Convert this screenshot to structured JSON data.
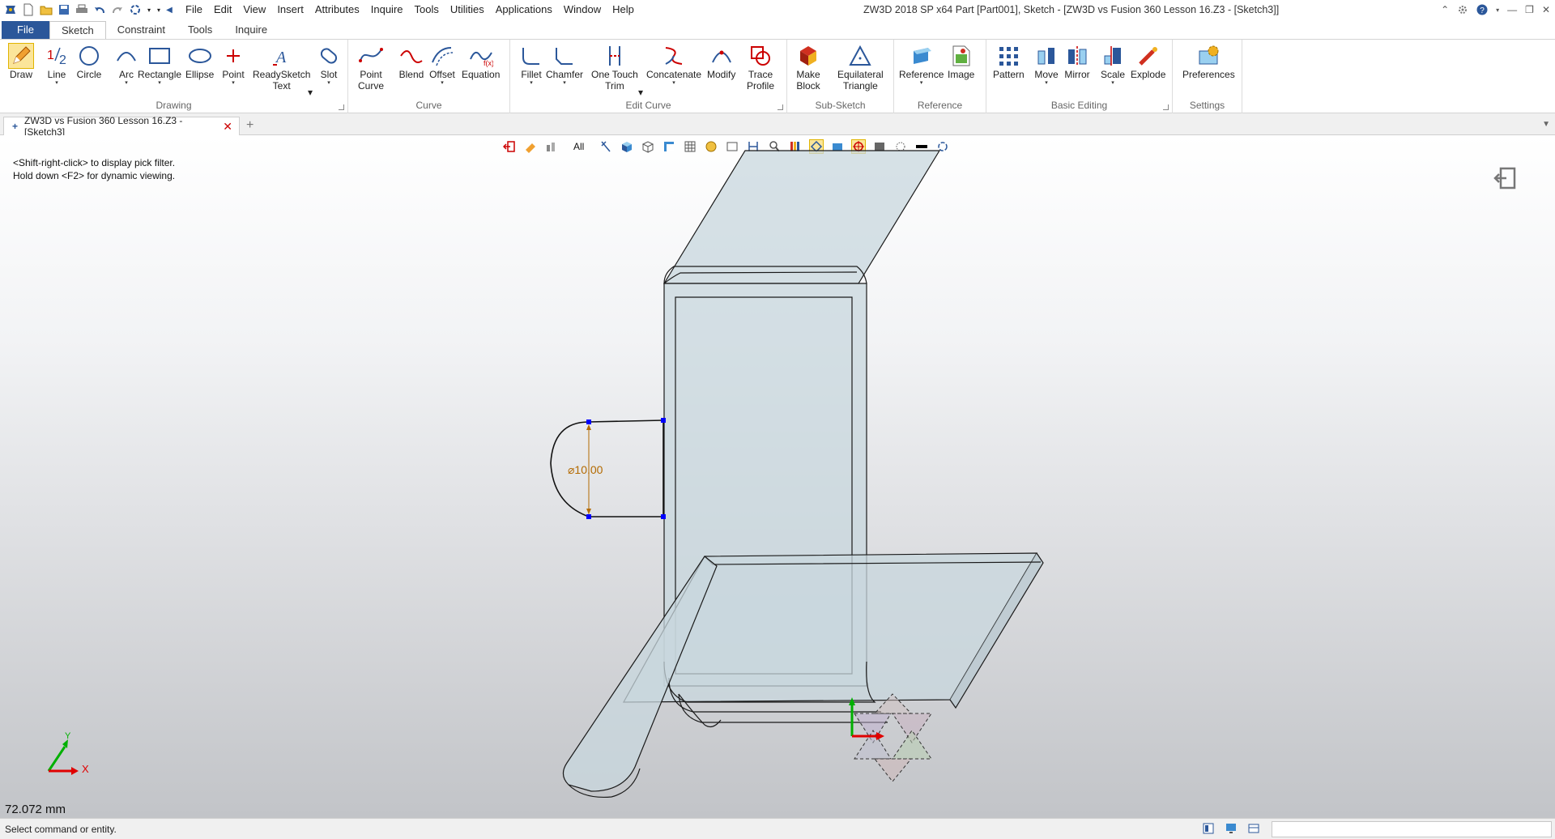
{
  "window": {
    "title": "ZW3D 2018 SP x64      Part [Part001],  Sketch - [ZW3D vs Fusion 360 Lesson 16.Z3 - [Sketch3]]"
  },
  "menu": [
    "File",
    "Edit",
    "View",
    "Insert",
    "Attributes",
    "Inquire",
    "Tools",
    "Utilities",
    "Applications",
    "Window",
    "Help"
  ],
  "ribbon_tabs": [
    "File",
    "Sketch",
    "Constraint",
    "Tools",
    "Inquire"
  ],
  "ribbon": {
    "groups": {
      "drawing": "Drawing",
      "curve": "Curve",
      "edit_curve": "Edit Curve",
      "sub_sketch": "Sub-Sketch",
      "reference": "Reference",
      "basic_editing": "Basic Editing",
      "settings": "Settings"
    },
    "buttons": {
      "draw": "Draw",
      "line": "Line",
      "circle": "Circle",
      "arc": "Arc",
      "rectangle": "Rectangle",
      "ellipse": "Ellipse",
      "point": "Point",
      "readysketch_1": "ReadySketch",
      "readysketch_2": "Text",
      "slot": "Slot",
      "point_curve_1": "Point",
      "point_curve_2": "Curve",
      "blend": "Blend",
      "offset": "Offset",
      "equation": "Equation",
      "fillet": "Fillet",
      "chamfer": "Chamfer",
      "one_touch_trim_1": "One Touch",
      "one_touch_trim_2": "Trim",
      "concatenate": "Concatenate",
      "modify": "Modify",
      "trace_profile_1": "Trace",
      "trace_profile_2": "Profile",
      "make_block_1": "Make",
      "make_block_2": "Block",
      "equilateral_triangle_1": "Equilateral",
      "equilateral_triangle_2": "Triangle",
      "reference": "Reference",
      "image": "Image",
      "pattern": "Pattern",
      "move": "Move",
      "mirror": "Mirror",
      "scale": "Scale",
      "explode": "Explode",
      "preferences": "Preferences"
    }
  },
  "document_tab": "ZW3D vs Fusion 360 Lesson 16.Z3 - [Sketch3]",
  "viewport": {
    "hint_line_1": "<Shift-right-click> to display pick filter.",
    "hint_line_2": "Hold down <F2> for dynamic viewing.",
    "filter_label": "All",
    "dimension_label": "⌀10.00",
    "distance_readout": "72.072 mm",
    "triad_x": "X",
    "triad_y": "Y"
  },
  "status": {
    "text": "Select command or entity."
  },
  "colors": {
    "file_tab": "#2b579a",
    "part_fill": "#c8d7de",
    "sketch_points": "#0000ff",
    "dimension": "#b36a00"
  }
}
